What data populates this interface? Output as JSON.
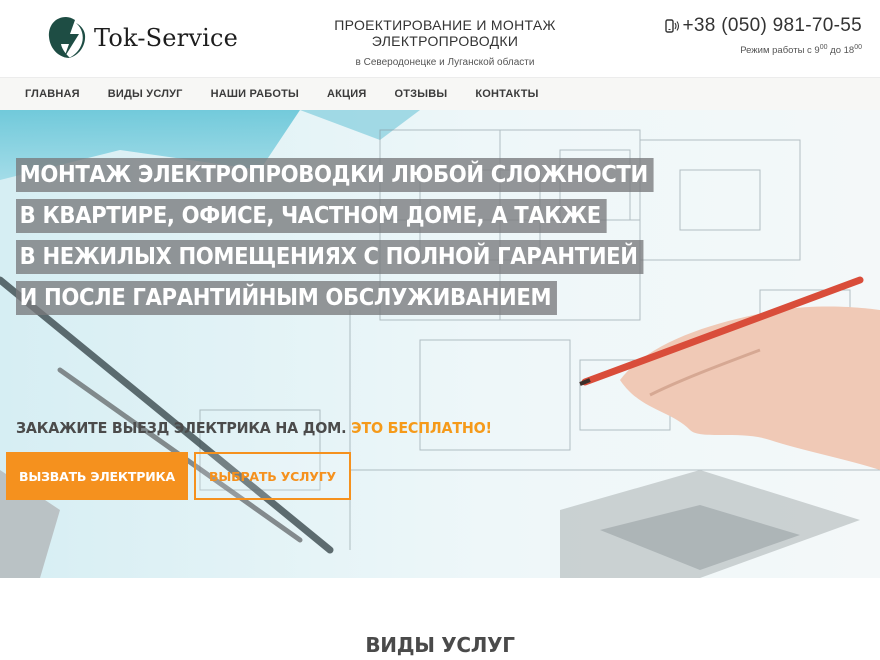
{
  "brand": {
    "name": "Tok-Service",
    "logo_icon": "lightning-bolt-icon"
  },
  "tagline": {
    "title": "ПРОЕКТИРОВАНИЕ И МОНТАЖ ЭЛЕКТРОПРОВОДКИ",
    "subtitle": "в Северодонецке и Луганской области"
  },
  "contact": {
    "phone_icon": "phone-icon",
    "phone": "+38 (050) 981-70-55",
    "hours_prefix": "Режим работы с 9",
    "hours_from_sup": "00",
    "hours_mid": " до 18",
    "hours_to_sup": "00"
  },
  "nav": {
    "items": [
      "ГЛАВНАЯ",
      "ВИДЫ УСЛУГ",
      "НАШИ РАБОТЫ",
      "АКЦИЯ",
      "ОТЗЫВЫ",
      "КОНТАКТЫ"
    ]
  },
  "hero": {
    "headline": [
      "МОНТАЖ ЭЛЕКТРОПРОВОДКИ ЛЮБОЙ СЛОЖНОСТИ",
      "В КВАРТИРЕ, ОФИСЕ, ЧАСТНОМ ДОМЕ, А ТАКЖЕ",
      "В НЕЖИЛЫХ ПОМЕЩЕНИЯХ С ПОЛНОЙ ГАРАНТИЕЙ",
      "И ПОСЛЕ ГАРАНТИЙНЫМ ОБСЛУЖИВАНИЕМ"
    ],
    "cta_text": "ЗАКАЖИТЕ ВЫЕЗД ЭЛЕКТРИКА НА ДОМ.",
    "cta_accent": "ЭТО БЕСПЛАТНО!",
    "primary_button": "ВЫЗВАТЬ ЭЛЕКТРИКА",
    "secondary_button": "ВЫБРАТЬ УСЛУГУ"
  },
  "section": {
    "title": "ВИДЫ УСЛУГ"
  },
  "colors": {
    "accent": "#f5911e",
    "text": "#333333",
    "nav_bg": "#f7f7f5",
    "logo": "#1e4d44"
  }
}
